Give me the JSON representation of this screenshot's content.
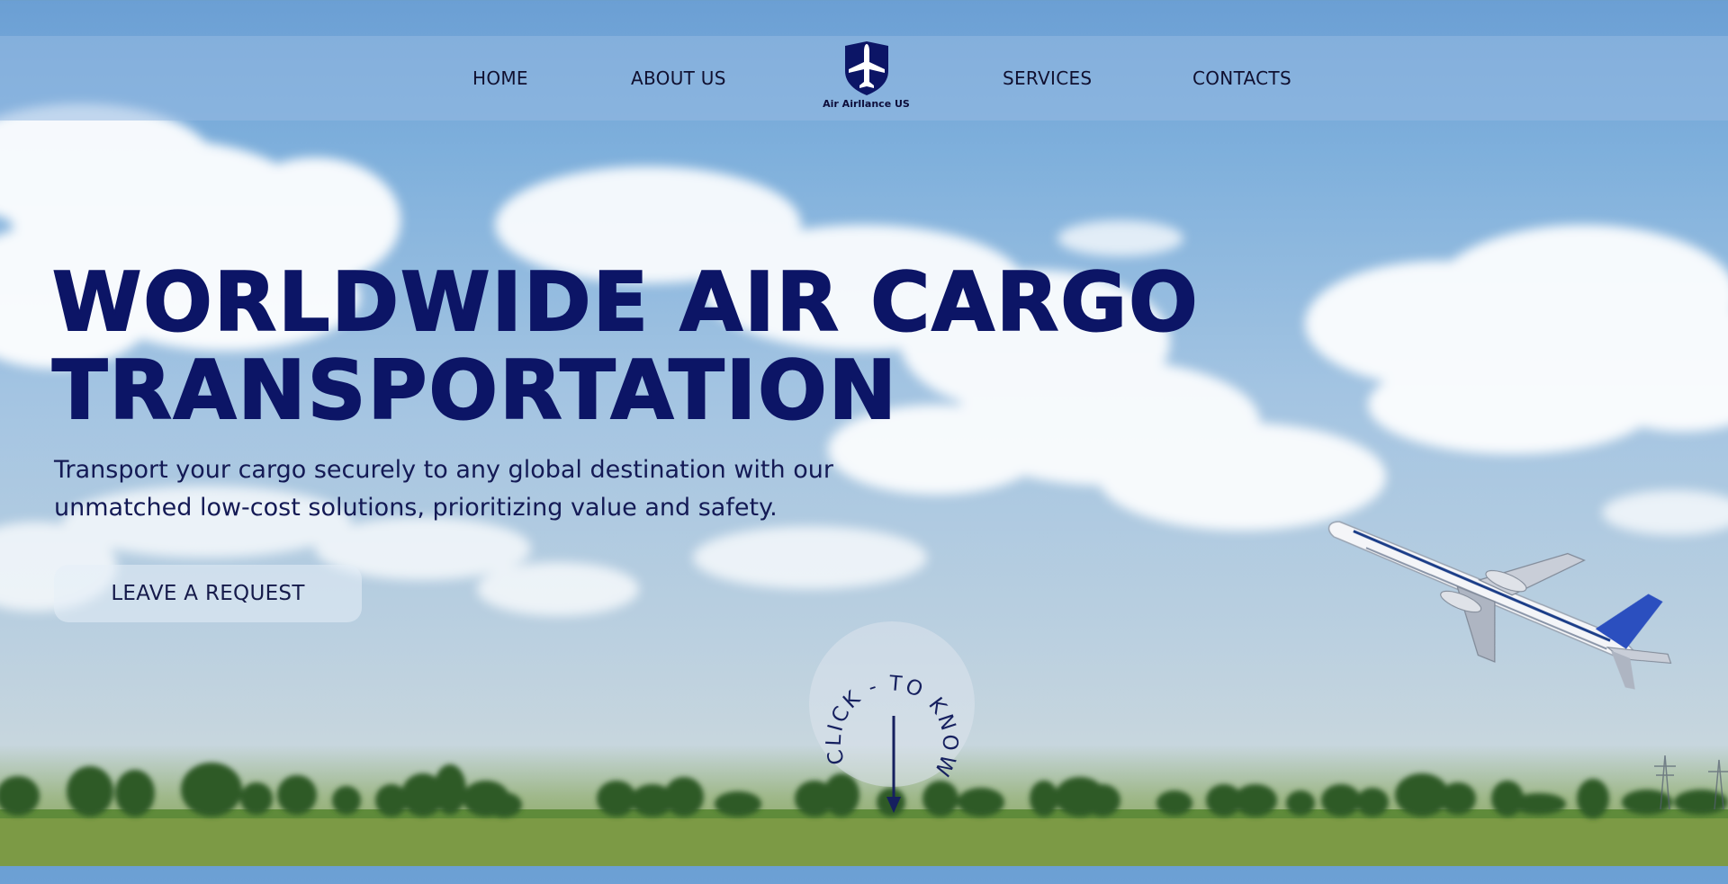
{
  "nav": {
    "items": [
      {
        "label": "HOME"
      },
      {
        "label": "ABOUT US"
      },
      {
        "label": "SERVICES"
      },
      {
        "label": "CONTACTS"
      }
    ],
    "logo_text": "Air Airllance US"
  },
  "hero": {
    "title_line1": "WORLDWIDE AIR CARGO",
    "title_line2": "TRANSPORTATION",
    "subtitle_line1": "Transport your cargo securely to any global destination with our",
    "subtitle_line2": "unmatched low-cost solutions, prioritizing value and safety.",
    "cta_label": "LEAVE A REQUEST"
  },
  "know_more": {
    "circle_text": "CLICK - TO KNOW - MORE"
  },
  "colors": {
    "accent": "#0c1566",
    "nav_bar": "#96b9e1",
    "grass": "#7d9b46"
  },
  "icons": {
    "logo": "shield-airplane-icon",
    "scroll": "arrow-down-icon"
  }
}
